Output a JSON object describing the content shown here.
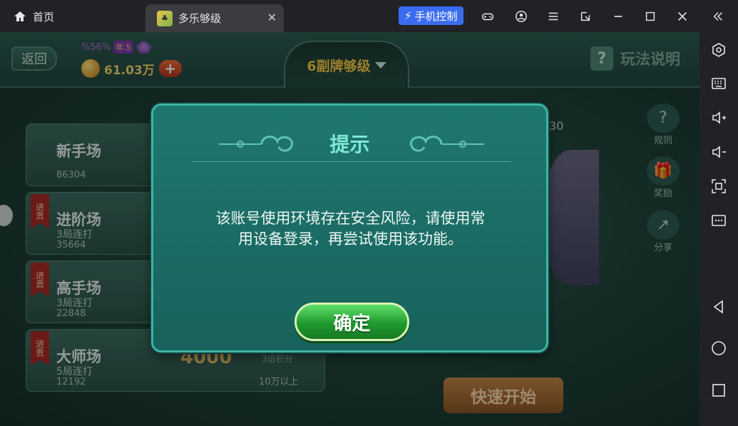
{
  "titlebar": {
    "home_label": "首页",
    "tab_label": "多乐够级",
    "phone_control_label": "手机控制"
  },
  "game": {
    "back_label": "返回",
    "vip_percent": "%56%",
    "vip_level": "年.5",
    "coins": "61.03万",
    "mode_label": "6副牌够级",
    "help_label": "玩法说明",
    "score_fragment": ".30",
    "quick_start_label": "快速开始",
    "rooms": [
      {
        "name": "新手场",
        "sub": "",
        "count": "86304",
        "tag": "",
        "bet": "",
        "rule": "",
        "min": ""
      },
      {
        "name": "进阶场",
        "sub": "3局连打",
        "count": "35664",
        "tag": "进贡",
        "bet": "",
        "rule": "",
        "min": ""
      },
      {
        "name": "高手场",
        "sub": "3局连打",
        "count": "22848",
        "tag": "进贡",
        "bet": "",
        "rule": "",
        "min": ""
      },
      {
        "name": "大师场",
        "sub": "5局连打",
        "count": "12192",
        "tag": "进贡",
        "bet": "4000",
        "rule": "3倍积分",
        "min": "10万以上"
      }
    ],
    "side_icons": [
      {
        "label": "规则",
        "icon": "rules-icon"
      },
      {
        "label": "奖励",
        "icon": "gift-icon"
      },
      {
        "label": "分享",
        "icon": "share-icon"
      }
    ]
  },
  "dialog": {
    "title": "提示",
    "message_line1": "该账号使用环境存在安全风险，请使用常",
    "message_line2": "用设备登录，再尝试使用该功能。",
    "confirm_label": "确定"
  },
  "colors": {
    "dialog_bg": "#1f7870",
    "dialog_border": "#3fb3a3",
    "title_color": "#7ee8d4",
    "confirm_green": "#1f9a2f",
    "accent_blue": "#3b6cf0"
  }
}
